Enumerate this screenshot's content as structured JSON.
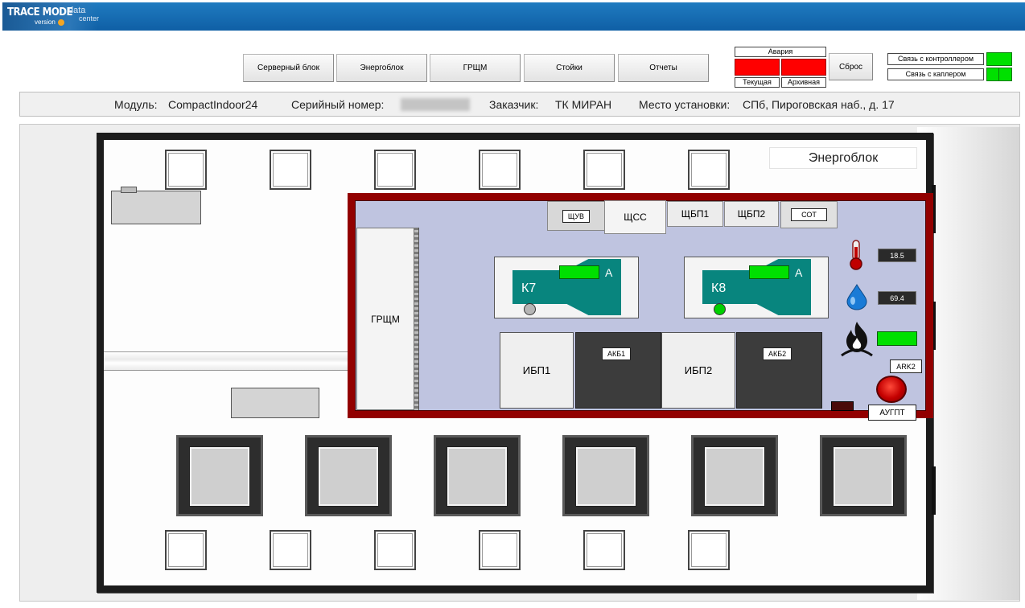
{
  "app": {
    "logo": {
      "main": "TRACE MODE",
      "version": "version",
      "data": "data",
      "center": "center"
    }
  },
  "nav": {
    "server": "Серверный блок",
    "energy": "Энергоблок",
    "grshm": "ГРЩМ",
    "racks": "Стойки",
    "reports": "Отчеты"
  },
  "alarms": {
    "title": "Авария",
    "current": "Текущая",
    "archive": "Архивная",
    "reset": "Сброс",
    "alarm_color": "#ff0000"
  },
  "connections": {
    "controller": "Связь с контроллером",
    "coupler": "Связь с каплером",
    "ok_color": "#00e000"
  },
  "info": {
    "module_label": "Модуль:",
    "module_value": "CompactIndoor24",
    "serial_label": "Серийный номер:",
    "customer_label": "Заказчик:",
    "customer_value": "ТК МИРАН",
    "location_label": "Место установки:",
    "location_value": "СПб, Пироговская наб., д. 17"
  },
  "plan": {
    "block_title": "Энергоблок",
    "grshm": "ГРЩМ",
    "panels": {
      "shchuv": "ЩУВ",
      "shchss": "ЩСС",
      "shchbp1": "ЩБП1",
      "shchbp2": "ЩБП2",
      "sot": "СОТ"
    },
    "ac_units": [
      {
        "label": "К7",
        "mode": "А",
        "dot_color": "#b5b5b5"
      },
      {
        "label": "К8",
        "mode": "А",
        "dot_color": "#00d000"
      }
    ],
    "ups": [
      {
        "label": "ИБП1",
        "battery": "АКБ1"
      },
      {
        "label": "ИБП2",
        "battery": "АКБ2"
      }
    ],
    "sensors": {
      "temperature": "18.5",
      "humidity": "69.4",
      "temperature_icon": "thermometer-icon",
      "humidity_icon": "water-drop-icon",
      "fire_icon": "fire-icon"
    },
    "ark_label": "ARK2",
    "augpt_label": "АУГПТ"
  }
}
